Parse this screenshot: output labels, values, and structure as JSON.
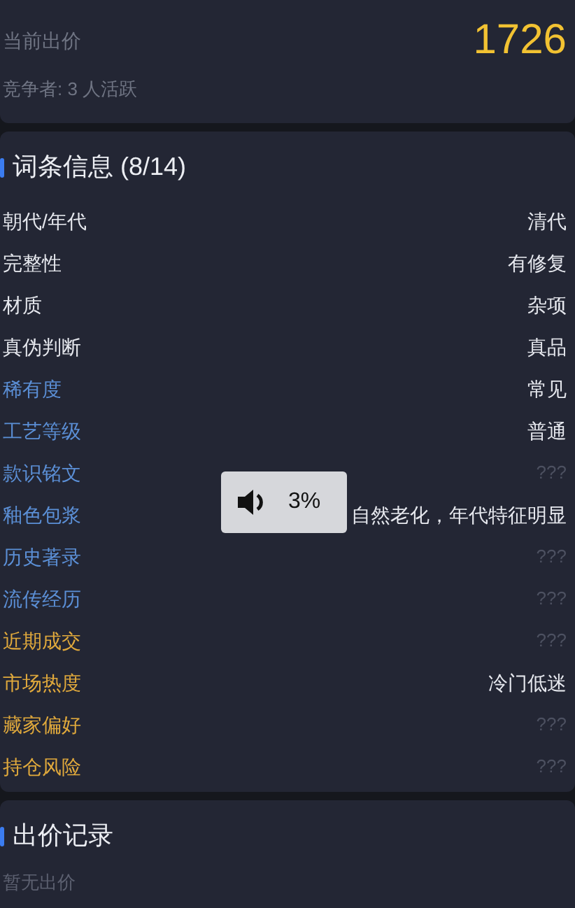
{
  "bid_card": {
    "label": "当前出价",
    "price": "1726",
    "competitors": "竞争者: 3 人活跃"
  },
  "attributes": {
    "title": "词条信息 (8/14)",
    "rows": [
      {
        "label": "朝代/年代",
        "value": "清代",
        "color": "#e6e8ee",
        "revealed": true
      },
      {
        "label": "完整性",
        "value": "有修复",
        "color": "#e6e8ee",
        "revealed": true
      },
      {
        "label": "材质",
        "value": "杂项",
        "color": "#e6e8ee",
        "revealed": true
      },
      {
        "label": "真伪判断",
        "value": "真品",
        "color": "#e6e8ee",
        "revealed": true
      },
      {
        "label": "稀有度",
        "value": "常见",
        "color": "#5b8fd6",
        "revealed": true
      },
      {
        "label": "工艺等级",
        "value": "普通",
        "color": "#5b8fd6",
        "revealed": true
      },
      {
        "label": "款识铭文",
        "value": "???",
        "color": "#5b8fd6",
        "revealed": false
      },
      {
        "label": "釉色包浆",
        "value": "自然老化，年代特征明显",
        "color": "#5b8fd6",
        "revealed": true
      },
      {
        "label": "历史著录",
        "value": "???",
        "color": "#5b8fd6",
        "revealed": false
      },
      {
        "label": "流传经历",
        "value": "???",
        "color": "#5b8fd6",
        "revealed": false
      },
      {
        "label": "近期成交",
        "value": "???",
        "color": "#e0a93c",
        "revealed": false
      },
      {
        "label": "市场热度",
        "value": "冷门低迷",
        "color": "#e0a93c",
        "revealed": true
      },
      {
        "label": "藏家偏好",
        "value": "???",
        "color": "#e0a93c",
        "revealed": false
      },
      {
        "label": "持仓风险",
        "value": "???",
        "color": "#e0a93c",
        "revealed": false
      }
    ]
  },
  "bid_history": {
    "title": "出价记录",
    "empty_text": "暂无出价"
  },
  "volume_hud": {
    "reading": "3%"
  }
}
